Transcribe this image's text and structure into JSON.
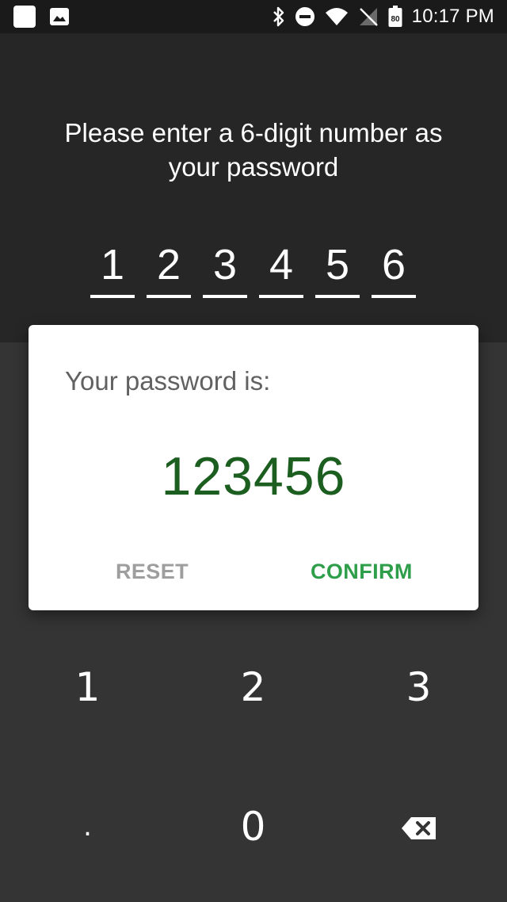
{
  "status_bar": {
    "time": "10:17 PM",
    "battery_level": "80",
    "left_icons": [
      "app-square-icon",
      "image-icon"
    ],
    "right_icons": [
      "bluetooth-icon",
      "do-not-disturb-icon",
      "wifi-icon",
      "no-signal-icon",
      "battery-icon"
    ]
  },
  "prompt": {
    "line1": "Please enter a 6-digit number as",
    "line2": "your password"
  },
  "digits": [
    "1",
    "2",
    "3",
    "4",
    "5",
    "6"
  ],
  "dialog": {
    "title": "Your password is:",
    "value": "123456",
    "reset_label": "RESET",
    "confirm_label": "CONFIRM",
    "value_color": "#1b5e20",
    "confirm_color": "#2e9e4b"
  },
  "keypad": {
    "keys": [
      "1",
      "2",
      "3",
      ".",
      "0"
    ],
    "delete_icon": "backspace-icon"
  }
}
